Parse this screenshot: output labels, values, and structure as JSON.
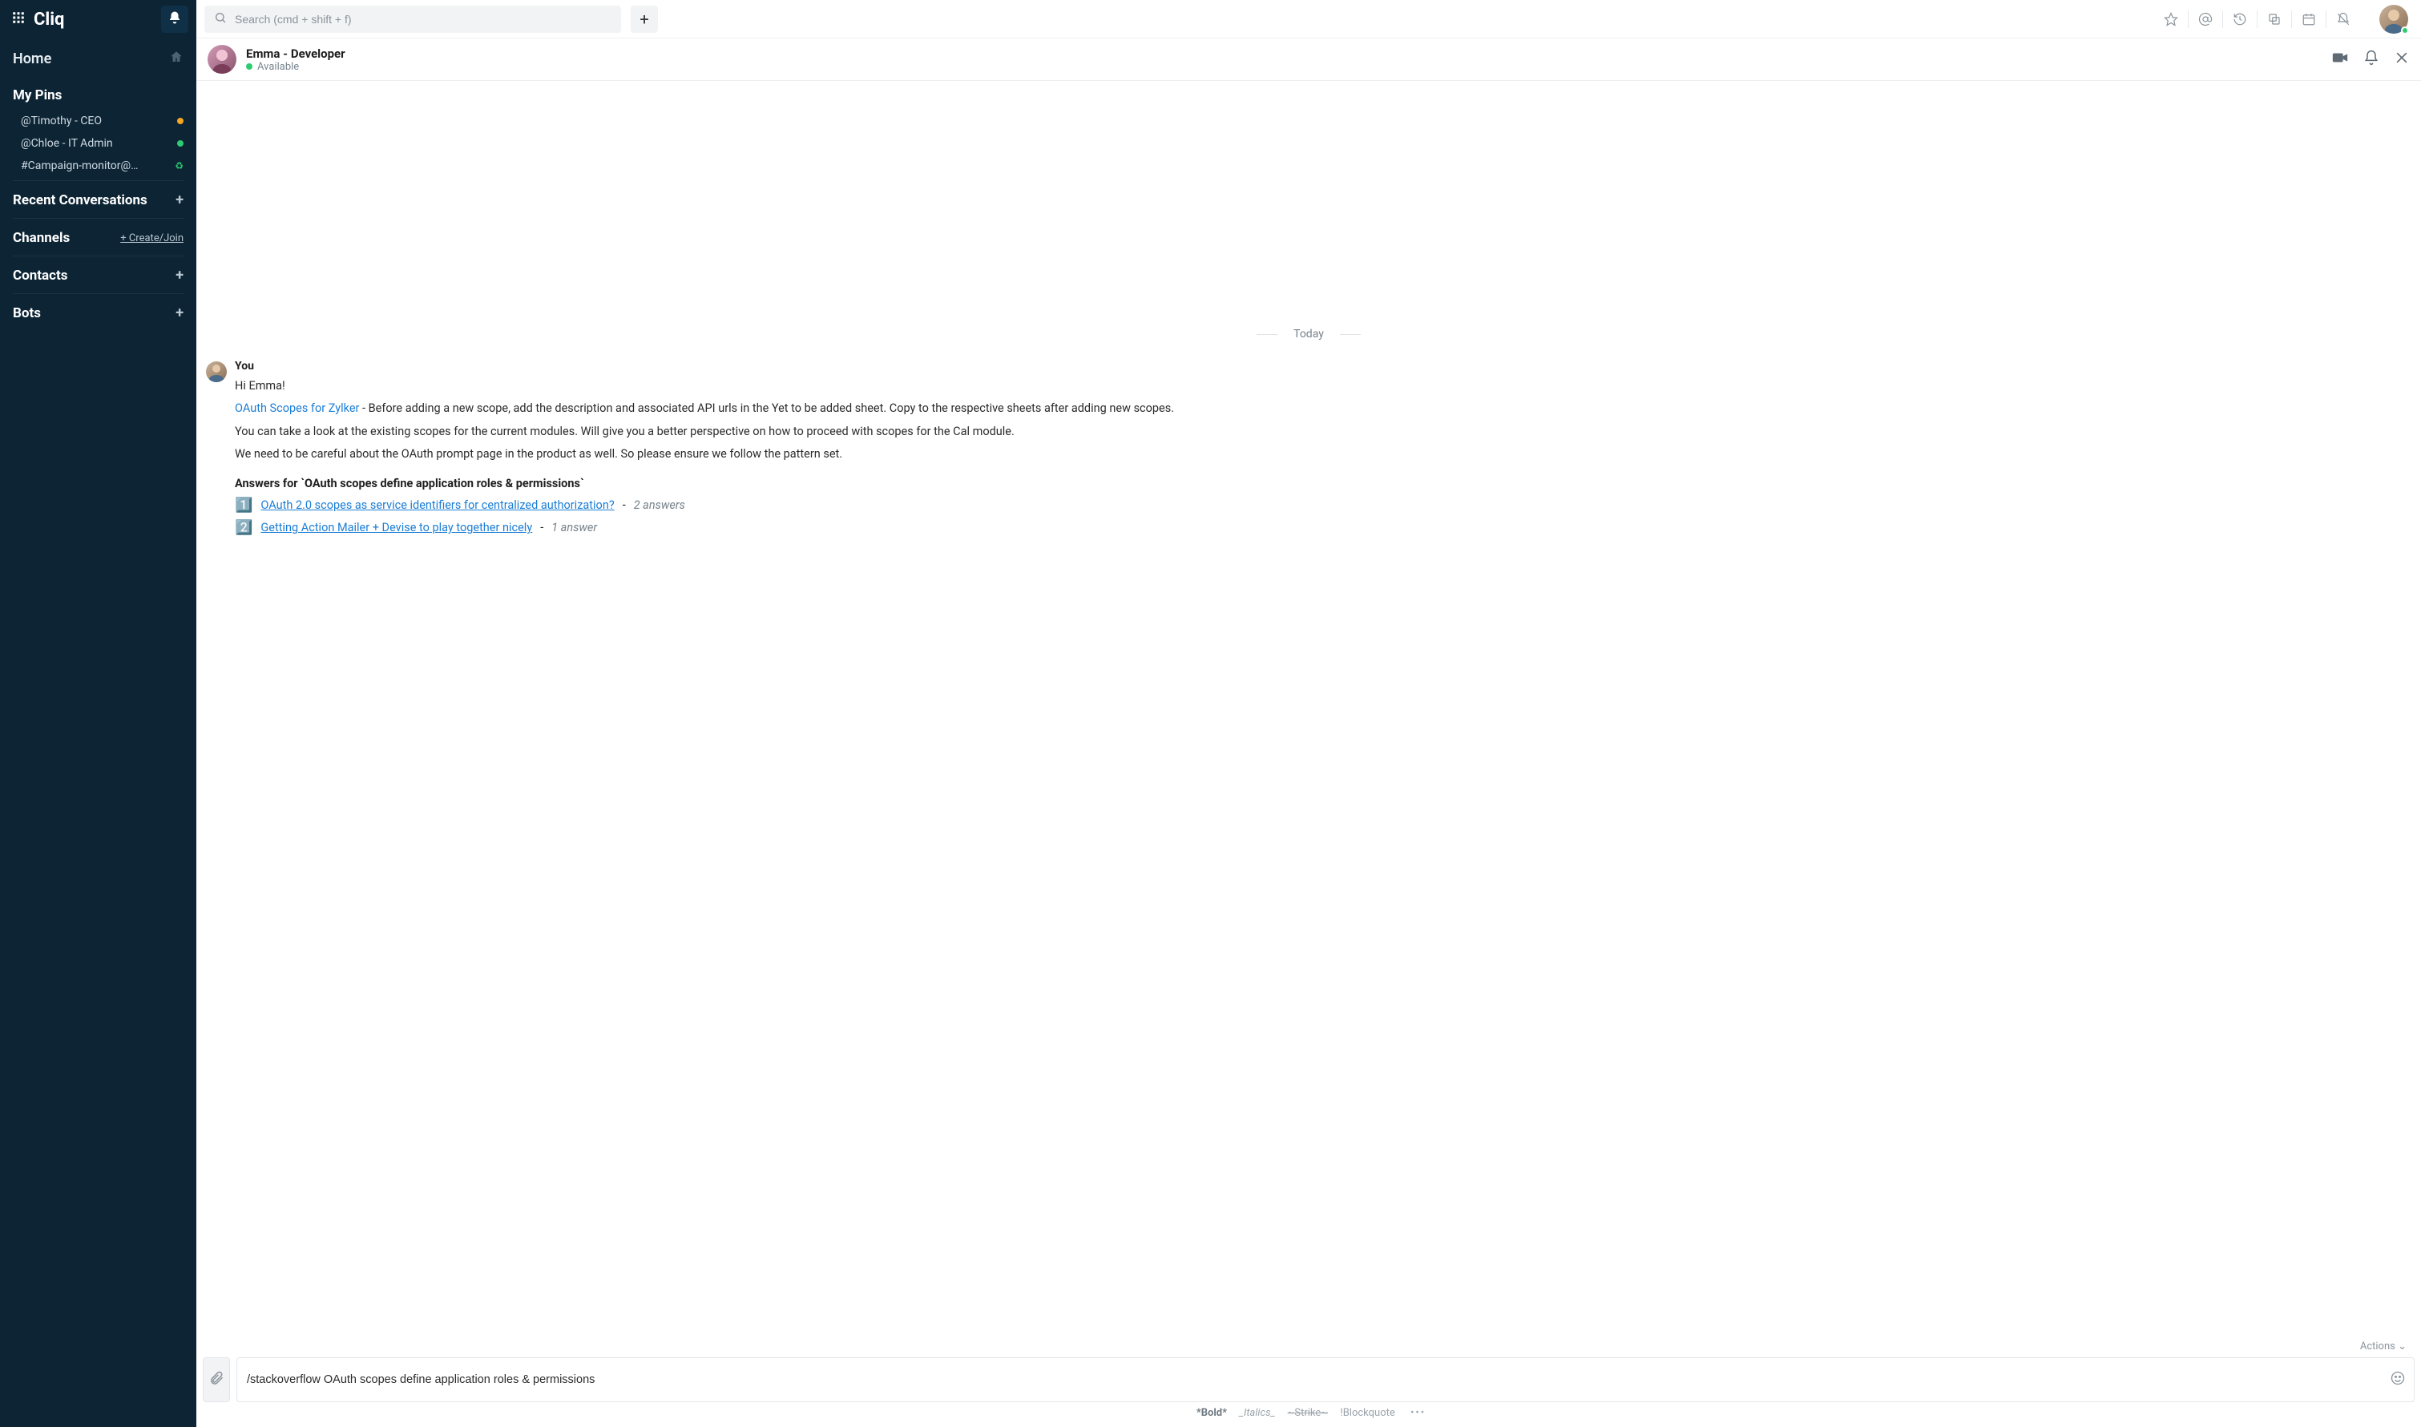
{
  "app": {
    "brand": "Cliq"
  },
  "search": {
    "placeholder": "Search (cmd + shift + f)"
  },
  "sidebar": {
    "home": "Home",
    "sections": {
      "pins": {
        "title": "My Pins",
        "items": [
          {
            "label": "@Timothy - CEO",
            "status": "away"
          },
          {
            "label": "@Chloe - IT Admin",
            "status": "online"
          },
          {
            "label": "#Campaign-monitor@…",
            "status": "bot"
          }
        ]
      },
      "recent": {
        "title": "Recent Conversations"
      },
      "channels": {
        "title": "Channels",
        "action": "+ Create/Join"
      },
      "contacts": {
        "title": "Contacts"
      },
      "bots": {
        "title": "Bots"
      }
    }
  },
  "chat_header": {
    "name": "Emma - Developer",
    "status_label": "Available"
  },
  "thread": {
    "date_label": "Today",
    "messages": [
      {
        "author": "You",
        "lines": [
          "Hi Emma!",
          "<a href=\"#\">OAuth Scopes for Zylker</a>  -  Before adding a new scope, add the description and associated API urls in the Yet to be added sheet. Copy to the respective sheets after adding new scopes.",
          "You can take a look at the existing scopes for the current modules. Will give you a better perspective on how to proceed with scopes for the Cal module.",
          "We need to be careful about the OAuth prompt page in the product as well. So please ensure we follow the pattern set."
        ],
        "answers_header": "Answers for `OAuth scopes define application roles & permissions`",
        "answers": [
          {
            "badge": "1️⃣",
            "title": "OAuth 2.0 scopes as service identifiers for centralized authorization?",
            "count": "2 answers"
          },
          {
            "badge": "2️⃣",
            "title": "Getting Action Mailer + Devise to play together nicely",
            "count": "1 answer"
          }
        ]
      }
    ]
  },
  "composer": {
    "actions_label": "Actions",
    "value": "/stackoverflow OAuth scopes define application roles & permissions"
  },
  "format_hints": {
    "bold": "*Bold*",
    "italics": "_Italics_",
    "strike": "~Strike~",
    "blockquote": "!Blockquote"
  }
}
